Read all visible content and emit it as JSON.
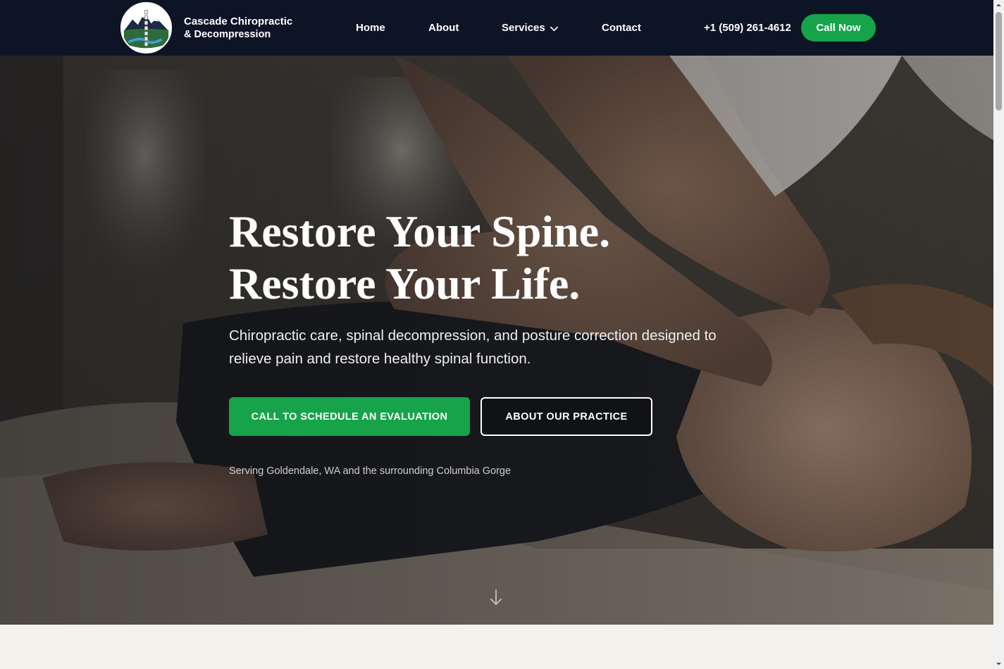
{
  "header": {
    "logo_icon": "mountain-spine-logo",
    "brand_line1": "Cascade Chiropractic",
    "brand_line2": "& Decompression",
    "nav": [
      {
        "label": "Home"
      },
      {
        "label": "About"
      },
      {
        "label": "Services",
        "icon": "chevron-down-icon"
      },
      {
        "label": "Contact"
      }
    ],
    "phone": "+1 (509) 261-4612",
    "cta_label": "Call Now"
  },
  "hero": {
    "title_line1": "Restore Your Spine.",
    "title_line2": "Restore Your Life.",
    "subtitle": "Chiropractic care, spinal decompression, and posture correction designed to relieve pain and restore healthy spinal function.",
    "primary_button": "CALL TO SCHEDULE AN EVALUATION",
    "secondary_button": "ABOUT OUR PRACTICE",
    "serving_text": "Serving Goldendale, WA and the surrounding Columbia Gorge",
    "scroll_icon": "arrow-down-icon"
  },
  "colors": {
    "nav_bg": "#0d1426",
    "accent_green": "#17a34a",
    "section_bg": "#f4f1ea"
  }
}
